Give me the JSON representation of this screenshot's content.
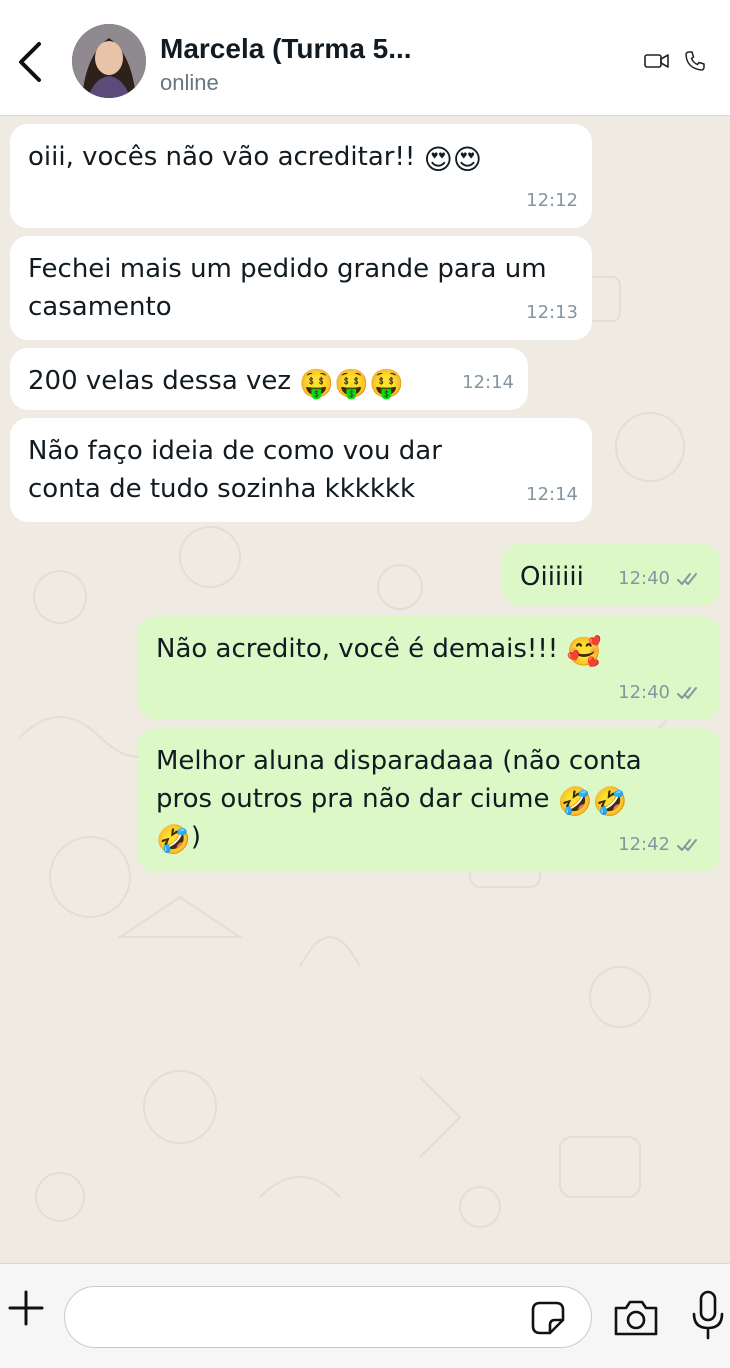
{
  "header": {
    "name": "Marcela  (Turma 5...",
    "status": "online",
    "back_icon": "chevron-left-icon",
    "video_icon": "video-call-icon",
    "phone_icon": "phone-call-icon"
  },
  "messages": [
    {
      "direction": "in",
      "text": "oiii, vocês não vão acreditar!! ",
      "emoji": "😍😍",
      "time": "12:12"
    },
    {
      "direction": "in",
      "text": "Fechei mais um pedido grande para um casamento",
      "emoji": "",
      "time": "12:13"
    },
    {
      "direction": "in",
      "text": "200 velas dessa vez ",
      "emoji": "🤑🤑🤑",
      "time": "12:14"
    },
    {
      "direction": "in",
      "text": "Não faço ideia de como vou dar conta de tudo sozinha kkkkkk",
      "emoji": "",
      "time": "12:14"
    },
    {
      "direction": "out",
      "text": "Oiiiiii",
      "emoji": "",
      "time": "12:40",
      "read": true
    },
    {
      "direction": "out",
      "text": "Não acredito, você é demais!!! ",
      "emoji": "🥰",
      "time": "12:40",
      "read": true
    },
    {
      "direction": "out",
      "text": "Melhor aluna disparadaaa (não conta pros outros pra não dar ciume ",
      "emoji": "🤣🤣",
      "emoji_after": "🤣",
      "tail": ")",
      "time": "12:42",
      "read": true
    }
  ],
  "composer": {
    "placeholder": "",
    "plus_icon": "plus-icon",
    "sticker_icon": "sticker-icon",
    "camera_icon": "camera-icon",
    "mic_icon": "microphone-icon"
  },
  "colors": {
    "incoming_bubble": "#ffffff",
    "outgoing_bubble": "#dcf8c6",
    "chat_background": "#efeae2",
    "read_ticks": "#8696a0"
  }
}
